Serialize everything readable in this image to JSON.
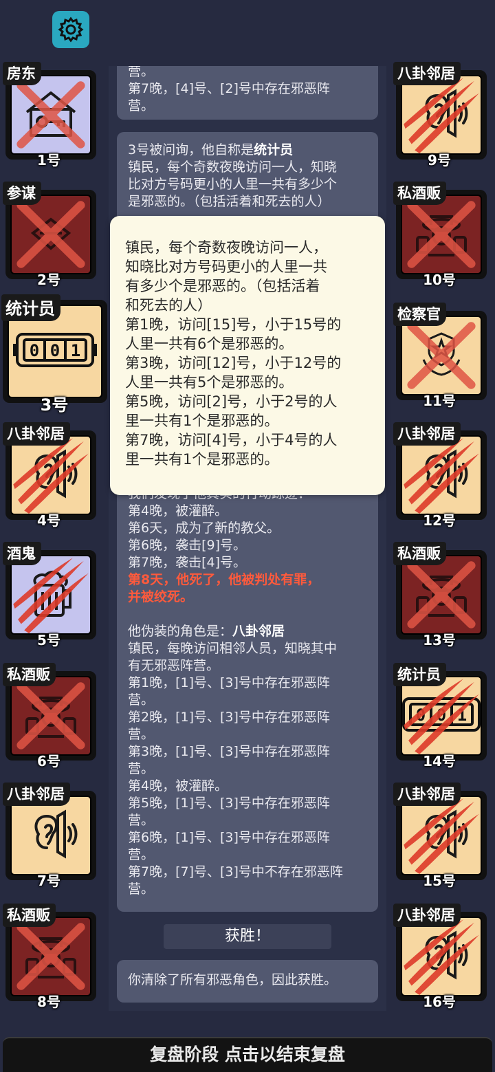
{
  "players": [
    {
      "num": "1号",
      "role": "房东",
      "bg": "lav",
      "icon": "house-key-icon",
      "state": "cross"
    },
    {
      "num": "2号",
      "role": "参谋",
      "bg": "red",
      "icon": "scroll-icon",
      "state": "cross"
    },
    {
      "num": "3号",
      "role": "统计员",
      "bg": "tan",
      "icon": "counter-icon",
      "state": "none"
    },
    {
      "num": "4号",
      "role": "八卦邻居",
      "bg": "tan",
      "icon": "ear-icon",
      "state": "claw"
    },
    {
      "num": "5号",
      "role": "酒鬼",
      "bg": "lav",
      "icon": "beer-mug-icon",
      "state": "claw"
    },
    {
      "num": "6号",
      "role": "私酒贩",
      "bg": "red",
      "icon": "smuggler-icon",
      "state": "cross"
    },
    {
      "num": "7号",
      "role": "八卦邻居",
      "bg": "tan",
      "icon": "ear-icon",
      "state": "none"
    },
    {
      "num": "8号",
      "role": "私酒贩",
      "bg": "red",
      "icon": "smuggler-icon",
      "state": "cross"
    },
    {
      "num": "9号",
      "role": "八卦邻居",
      "bg": "tan",
      "icon": "ear-icon",
      "state": "claw"
    },
    {
      "num": "10号",
      "role": "私酒贩",
      "bg": "red",
      "icon": "smuggler-icon",
      "state": "cross"
    },
    {
      "num": "11号",
      "role": "检察官",
      "bg": "tan",
      "icon": "badge-icon",
      "state": "cross"
    },
    {
      "num": "12号",
      "role": "八卦邻居",
      "bg": "tan",
      "icon": "ear-icon",
      "state": "claw"
    },
    {
      "num": "13号",
      "role": "私酒贩",
      "bg": "red",
      "icon": "smuggler-icon",
      "state": "cross"
    },
    {
      "num": "14号",
      "role": "统计员",
      "bg": "tan",
      "icon": "counter-icon",
      "state": "claw"
    },
    {
      "num": "15号",
      "role": "八卦邻居",
      "bg": "tan",
      "icon": "ear-icon",
      "state": "claw"
    },
    {
      "num": "16号",
      "role": "八卦邻居",
      "bg": "tan",
      "icon": "ear-icon",
      "state": "claw"
    }
  ],
  "counter_digits": "001",
  "log": {
    "b1": [
      "营。",
      "第7晚，[4]号、[2]号中存在邪恶阵",
      "营。"
    ],
    "b2_intro": "3号被问询，他自称是",
    "b2_role": "统计员",
    "b2_lines": [
      "镇民，每个奇数夜晚访问一人，知晓",
      "比对方号码更小的人里一共有多少个",
      "是邪恶的。（包括活着和死去的人）"
    ],
    "b2_trace": [
      "我们发现了他真实的行动踪迹：",
      "第4晚，被灌醉。",
      "第6天，成为了新的教父。",
      "第6晚，袭击[9]号。",
      "第7晚，袭击[4]号。"
    ],
    "b2_death": [
      "第8天，他死了，他被判处有罪，",
      "并被绞死。"
    ],
    "b2_fake_intro": "他伪装的角色是：",
    "b2_fake_role": "八卦邻居",
    "b2_fake_lines": [
      "镇民，每晚访问相邻人员，知晓其中",
      "有无邪恶阵营。",
      "第1晚，[1]号、[3]号中存在邪恶阵",
      "营。",
      "第2晚，[1]号、[3]号中存在邪恶阵",
      "营。",
      "第3晚，[1]号、[3]号中存在邪恶阵",
      "营。",
      "第4晚，被灌醉。",
      "第5晚，[1]号、[3]号中存在邪恶阵",
      "营。",
      "第6晚，[1]号、[3]号中存在邪恶阵",
      "营。",
      "第7晚，[7]号、[3]号中不存在邪恶阵",
      "营。"
    ],
    "win_label": "获胜！",
    "final": "你清除了所有邪恶角色，因此获胜。"
  },
  "tooltip": {
    "lines": [
      "镇民，每个奇数夜晚访问一人，",
      "知晓比对方号码更小的人里一共",
      "有多少个是邪恶的。（包括活着",
      "和死去的人）",
      "第1晚，访问[15]号，小于15号的",
      "人里一共有6个是邪恶的。",
      "第3晚，访问[12]号，小于12号的",
      "人里一共有5个是邪恶的。",
      "第5晚，访问[2]号，小于2号的人",
      "里一共有1个是邪恶的。",
      "第7晚，访问[4]号，小于4号的人",
      "里一共有1个是邪恶的。"
    ]
  },
  "bottom_bar": "复盘阶段 点击以结束复盘",
  "colors": {
    "cross": "#e05545",
    "claw": "#dd3b2a",
    "tan": "#f7d7a1",
    "lav": "#c5c4ee",
    "red": "#7c2323"
  }
}
